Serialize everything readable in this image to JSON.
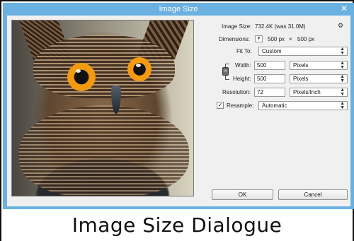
{
  "window": {
    "title": "Image Size"
  },
  "form": {
    "image_size_label": "Image Size:",
    "image_size_value": "732.4K (was 31.0M)",
    "dimensions_label": "Dimensions:",
    "dimensions_width": "500 px",
    "dimensions_sep": "×",
    "dimensions_height": "500 px",
    "fit_to_label": "Fit To:",
    "fit_to_value": "Custom",
    "width_label": "Width:",
    "width_value": "500",
    "width_unit": "Pixels",
    "height_label": "Height:",
    "height_value": "500",
    "height_unit": "Pixels",
    "resolution_label": "Resolution:",
    "resolution_value": "72",
    "resolution_unit": "Pixels/Inch",
    "resample_label": "Resample:",
    "resample_checked": true,
    "resample_value": "Automatic"
  },
  "buttons": {
    "ok": "OK",
    "cancel": "Cancel"
  },
  "caption": "Image Size Dialogue",
  "icons": {
    "close": "close-icon",
    "gear": "gear-icon",
    "dropdown": "chevron-down-icon",
    "link": "link-icon",
    "check": "checkmark-icon"
  },
  "colors": {
    "window_frame": "#6ab0e0",
    "dialog_bg": "#f0f0f0",
    "eye": "#f39a10"
  }
}
